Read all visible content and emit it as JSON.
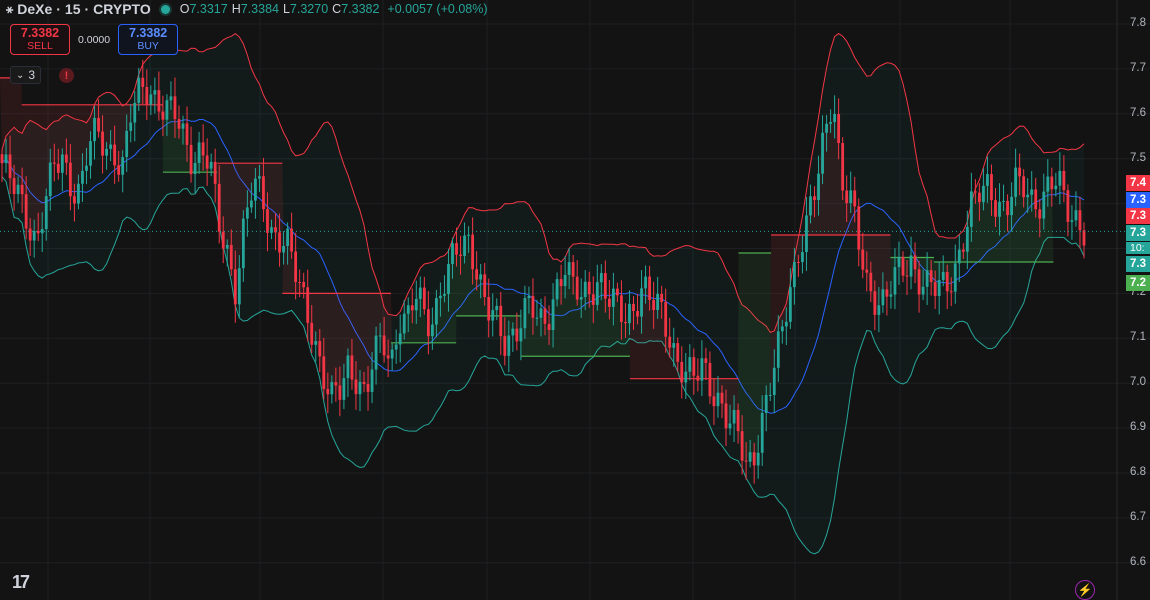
{
  "header": {
    "symbol": "DeXe",
    "interval": "15",
    "exchange": "CRYPTO",
    "sep": "·",
    "open_label": "O",
    "open": "7.3317",
    "high_label": "H",
    "high": "7.3384",
    "low_label": "L",
    "low": "7.3270",
    "close_label": "C",
    "close": "7.3382",
    "change": "+0.0057 (+0.08%)"
  },
  "trade": {
    "sell_price": "7.3382",
    "sell_label": "SELL",
    "spread": "0.0000",
    "buy_price": "7.3382",
    "buy_label": "BUY"
  },
  "indicators": {
    "count": "3",
    "warning": "!"
  },
  "price_axis": {
    "ticks": [
      "7.8",
      "7.7",
      "7.6",
      "7.5",
      "7.4",
      "7.3",
      "7.2",
      "7.1",
      "7.0",
      "6.9",
      "6.8",
      "6.7",
      "6.6"
    ],
    "tags": [
      {
        "text": "7.4",
        "color": "#f23645"
      },
      {
        "text": "7.3",
        "color": "#2962ff"
      },
      {
        "text": "7.3",
        "color": "#f23645"
      },
      {
        "text": "7.3",
        "color": "#26a69a"
      },
      {
        "text": "7.3",
        "color": "#26a69a"
      },
      {
        "text": "7.2",
        "color": "#4caf50"
      }
    ],
    "countdown": "10:"
  },
  "colors": {
    "background": "#131313",
    "up": "#26a69a",
    "down": "#f23645",
    "upper_band": "#f23645",
    "lower_band": "#26a69a",
    "basis": "#2962ff",
    "stop_up": "#4caf50"
  },
  "icons": {
    "logo": "tradingview-logo-icon",
    "bolt": "lightning-icon"
  },
  "chart_data": {
    "type": "candlestick",
    "ylim": [
      6.6,
      7.8
    ],
    "grid": true,
    "close_path": [
      7.49,
      7.44,
      7.41,
      7.37,
      7.32,
      7.4,
      7.47,
      7.5,
      7.45,
      7.43,
      7.52,
      7.55,
      7.53,
      7.52,
      7.48,
      7.6,
      7.65,
      7.67,
      7.63,
      7.6,
      7.59,
      7.55,
      7.51,
      7.52,
      7.48,
      7.35,
      7.3,
      7.22,
      7.35,
      7.43,
      7.42,
      7.35,
      7.33,
      7.3,
      7.23,
      7.18,
      7.12,
      7.02,
      6.95,
      6.98,
      7.05,
      7.02,
      6.96,
      7.05,
      7.1,
      7.06,
      7.15,
      7.13,
      7.2,
      7.14,
      7.17,
      7.22,
      7.26,
      7.3,
      7.33,
      7.25,
      7.16,
      7.13,
      7.09,
      7.12,
      7.15,
      7.17,
      7.12,
      7.15,
      7.22,
      7.26,
      7.2,
      7.19,
      7.22,
      7.24,
      7.18,
      7.16,
      7.15,
      7.18,
      7.22,
      7.17,
      7.16,
      7.12,
      7.06,
      7.02,
      7.0,
      7.04,
      7.0,
      6.96,
      6.9,
      6.88,
      6.82,
      6.86,
      6.93,
      7.0,
      7.1,
      7.22,
      7.3,
      7.35,
      7.42,
      7.55,
      7.66,
      7.45,
      7.4,
      7.3,
      7.22,
      7.2,
      7.18,
      7.22,
      7.25,
      7.28,
      7.24,
      7.21,
      7.2,
      7.22,
      7.26,
      7.32,
      7.38,
      7.42,
      7.45,
      7.41,
      7.38,
      7.43,
      7.44,
      7.42,
      7.41,
      7.43,
      7.44,
      7.4,
      7.38,
      7.34
    ],
    "stop_segments": [
      {
        "x0": 0,
        "x1": 0.02,
        "y": 7.68,
        "dir": "down"
      },
      {
        "x0": 0.02,
        "x1": 0.15,
        "y": 7.62,
        "dir": "down"
      },
      {
        "x0": 0.15,
        "x1": 0.2,
        "y": 7.47,
        "dir": "up"
      },
      {
        "x0": 0.2,
        "x1": 0.26,
        "y": 7.49,
        "dir": "down"
      },
      {
        "x0": 0.26,
        "x1": 0.36,
        "y": 7.2,
        "dir": "down"
      },
      {
        "x0": 0.36,
        "x1": 0.42,
        "y": 7.09,
        "dir": "up"
      },
      {
        "x0": 0.42,
        "x1": 0.48,
        "y": 7.15,
        "dir": "up"
      },
      {
        "x0": 0.48,
        "x1": 0.58,
        "y": 7.06,
        "dir": "up"
      },
      {
        "x0": 0.58,
        "x1": 0.68,
        "y": 7.01,
        "dir": "down"
      },
      {
        "x0": 0.68,
        "x1": 0.71,
        "y": 7.29,
        "dir": "up"
      },
      {
        "x0": 0.71,
        "x1": 0.82,
        "y": 7.33,
        "dir": "down"
      },
      {
        "x0": 0.82,
        "x1": 0.86,
        "y": 7.28,
        "dir": "up"
      },
      {
        "x0": 0.86,
        "x1": 0.97,
        "y": 7.27,
        "dir": "up"
      }
    ]
  }
}
